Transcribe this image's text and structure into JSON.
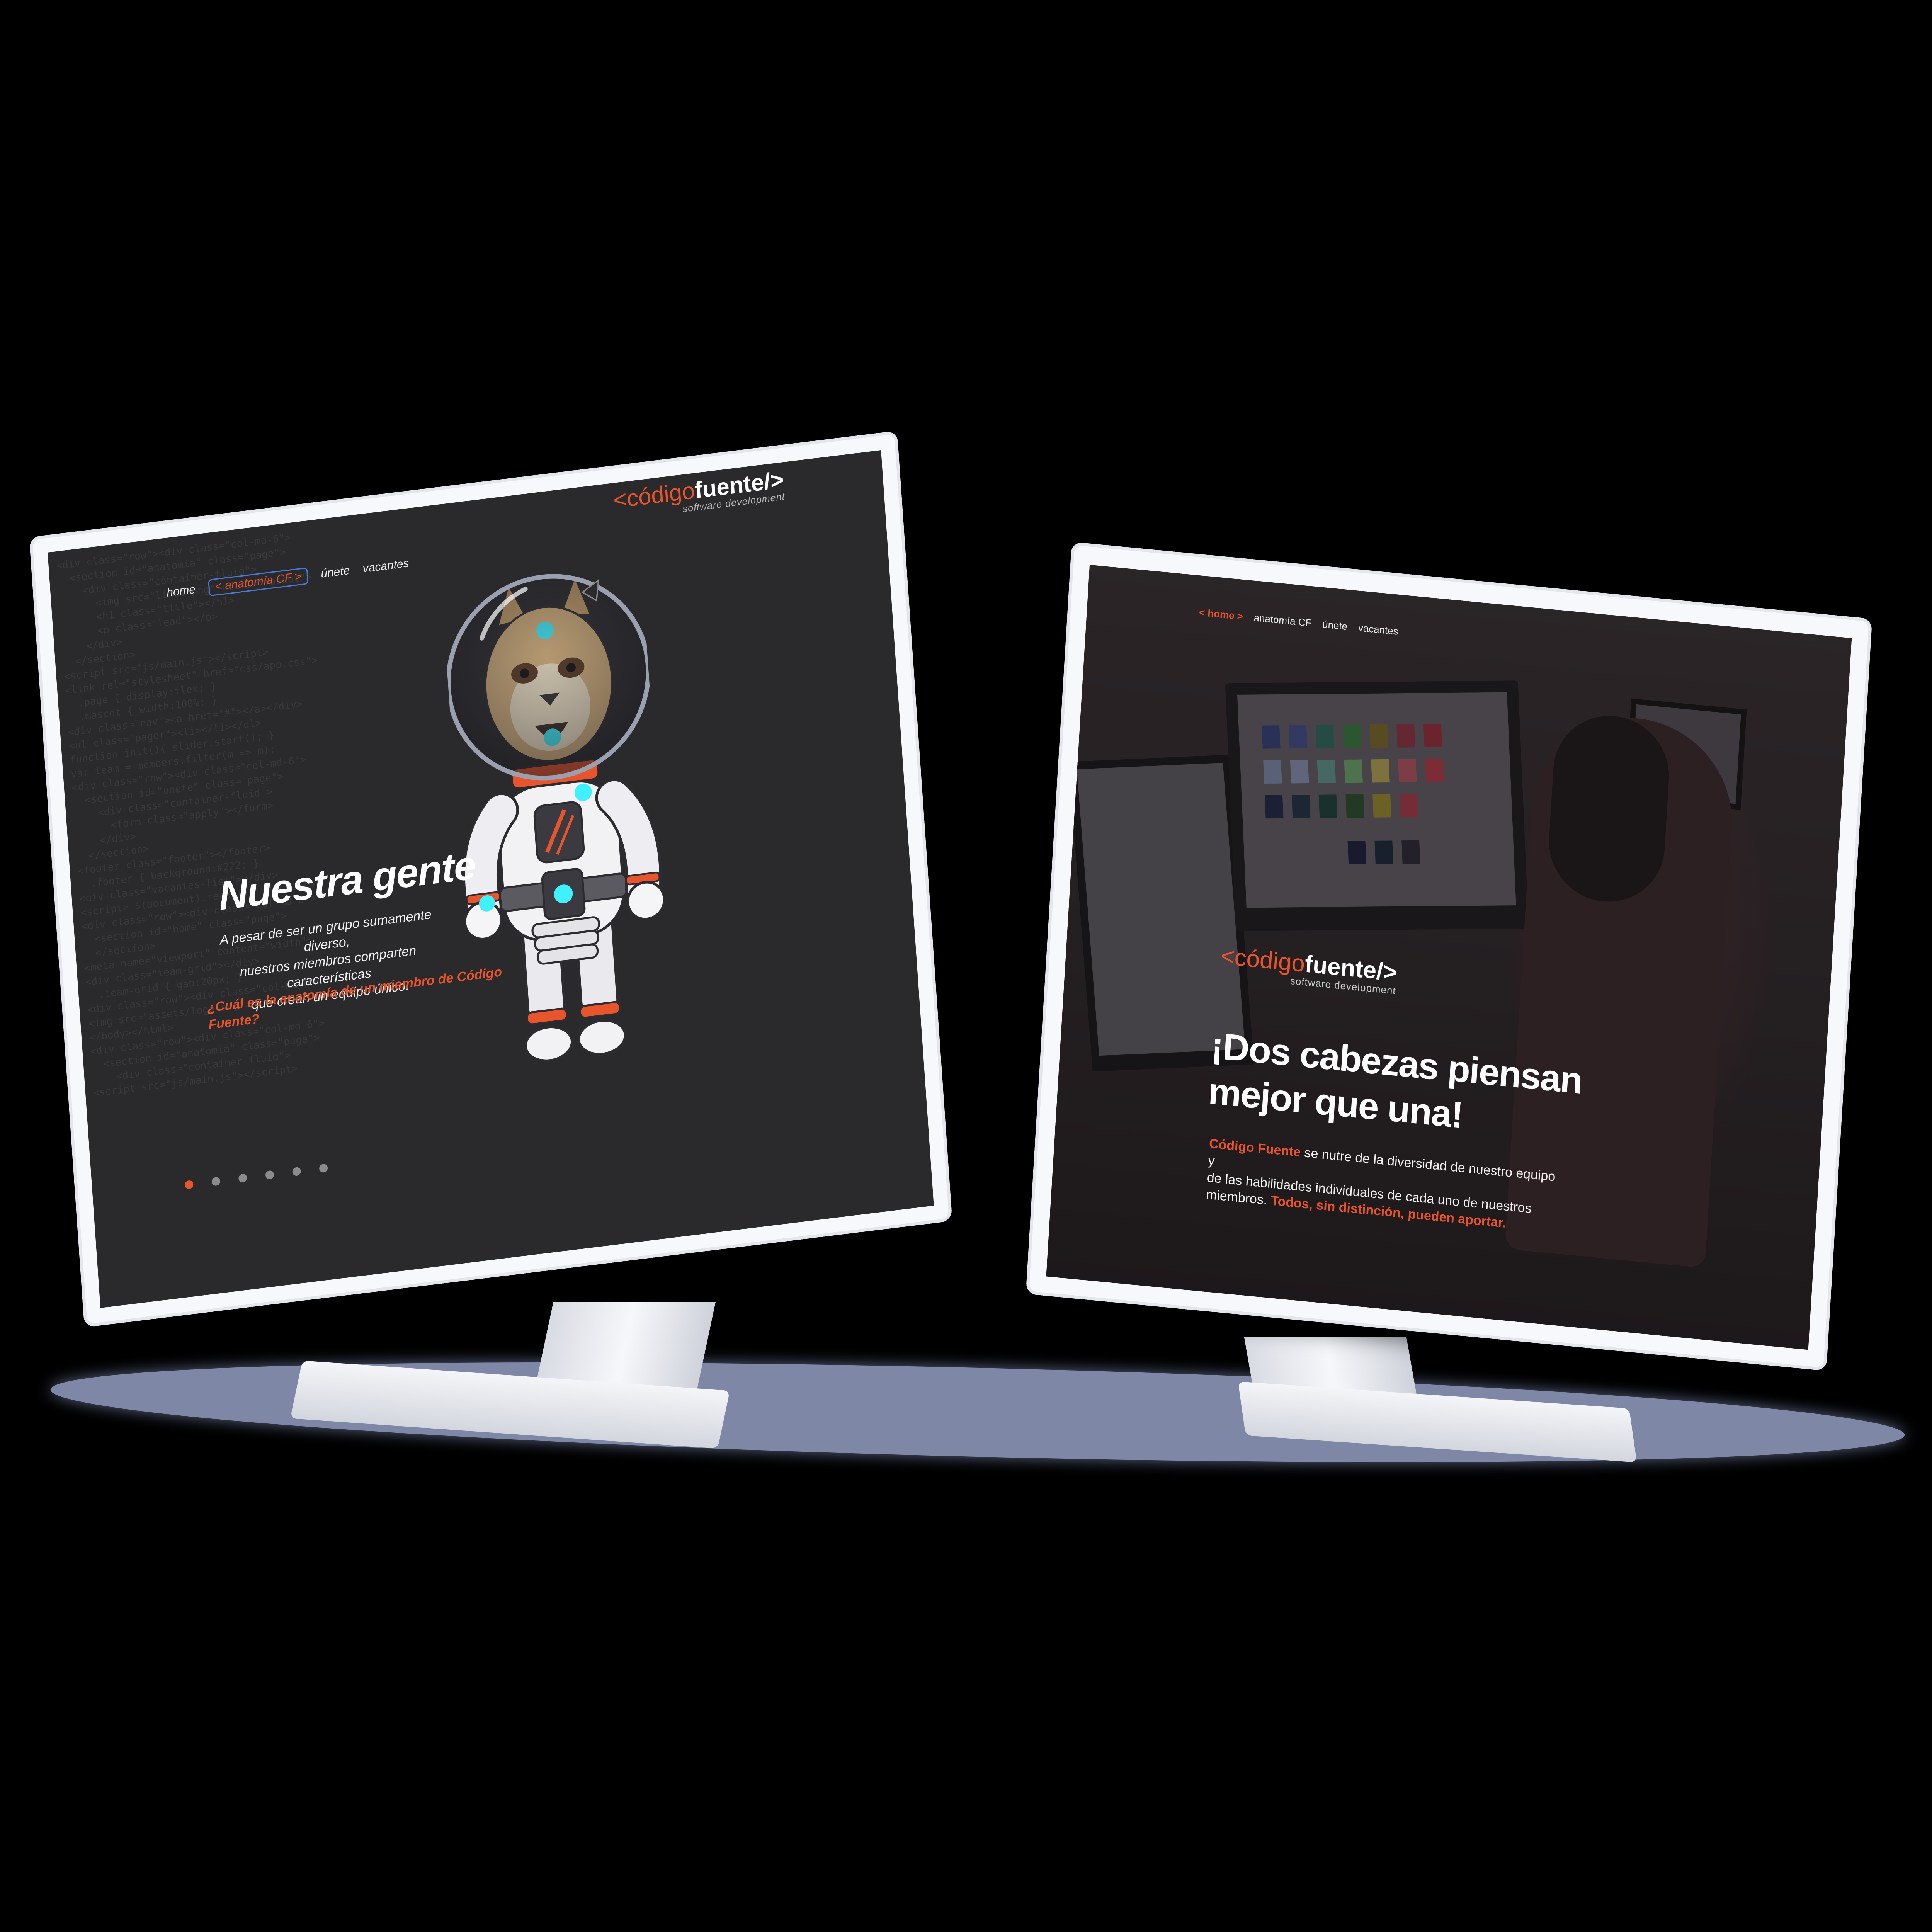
{
  "left_screen": {
    "nav": {
      "home": "home",
      "anatomia": "< anatomía CF >",
      "unete": "únete",
      "vacantes": "vacantes"
    },
    "logo": {
      "open": "<",
      "codigo": "código",
      "fuente": "fuente",
      "close": "/>",
      "tagline": "software development"
    },
    "heading": "Nuestra gente",
    "paragraph_lines": [
      "A pesar de ser un grupo sumamente diverso,",
      "nuestros miembros comparten características",
      "que crean un equipo único."
    ],
    "link_lines": [
      "¿Cuál es la anatomía de un miembro de Código",
      "Fuente?"
    ],
    "pager": {
      "count": 6,
      "active_index": 0
    },
    "mascot": "lynx-astronaut-mascot"
  },
  "right_screen": {
    "nav": {
      "home": "< home >",
      "anatomia": "anatomía CF",
      "unete": "únete",
      "vacantes": "vacantes"
    },
    "logo": {
      "open": "<",
      "codigo": "código",
      "fuente": "fuente",
      "close": "/>",
      "tagline": "software development"
    },
    "heading_lines": [
      "¡Dos cabezas piensan",
      "mejor que una!"
    ],
    "body": {
      "brand": "Código Fuente",
      "text1": " se nutre de la diversidad de nuestro equipo y",
      "text2": "de las habilidades individuales de cada uno de nuestros",
      "text3": "miembros. ",
      "highlight": "Todos, sin distinción, pueden aportar."
    }
  },
  "colors": {
    "accent": "#e8542b",
    "screen_bg": "#2a292c",
    "bezel": "#f7f8fb",
    "visor_light": "#3ff0ff",
    "floor": "#7e87a6"
  }
}
